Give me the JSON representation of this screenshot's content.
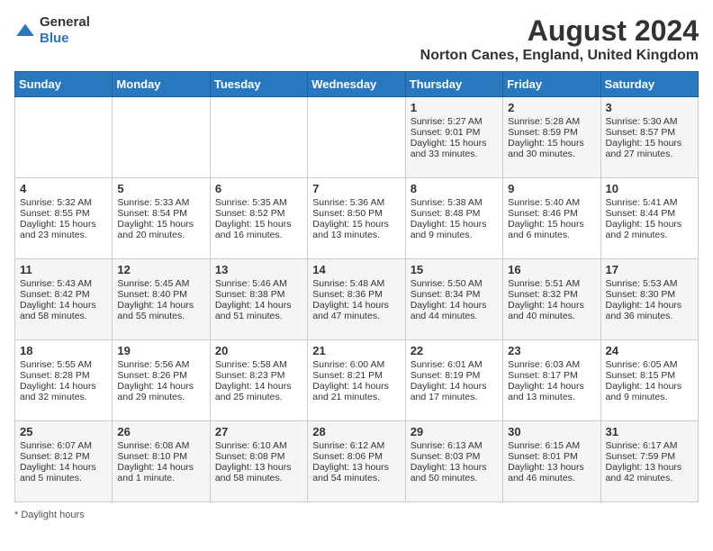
{
  "header": {
    "logo_general": "General",
    "logo_blue": "Blue",
    "main_title": "August 2024",
    "subtitle": "Norton Canes, England, United Kingdom"
  },
  "days_of_week": [
    "Sunday",
    "Monday",
    "Tuesday",
    "Wednesday",
    "Thursday",
    "Friday",
    "Saturday"
  ],
  "weeks": [
    [
      {
        "day": "",
        "sunrise": "",
        "sunset": "",
        "daylight": ""
      },
      {
        "day": "",
        "sunrise": "",
        "sunset": "",
        "daylight": ""
      },
      {
        "day": "",
        "sunrise": "",
        "sunset": "",
        "daylight": ""
      },
      {
        "day": "",
        "sunrise": "",
        "sunset": "",
        "daylight": ""
      },
      {
        "day": "1",
        "sunrise": "Sunrise: 5:27 AM",
        "sunset": "Sunset: 9:01 PM",
        "daylight": "Daylight: 15 hours and 33 minutes."
      },
      {
        "day": "2",
        "sunrise": "Sunrise: 5:28 AM",
        "sunset": "Sunset: 8:59 PM",
        "daylight": "Daylight: 15 hours and 30 minutes."
      },
      {
        "day": "3",
        "sunrise": "Sunrise: 5:30 AM",
        "sunset": "Sunset: 8:57 PM",
        "daylight": "Daylight: 15 hours and 27 minutes."
      }
    ],
    [
      {
        "day": "4",
        "sunrise": "Sunrise: 5:32 AM",
        "sunset": "Sunset: 8:55 PM",
        "daylight": "Daylight: 15 hours and 23 minutes."
      },
      {
        "day": "5",
        "sunrise": "Sunrise: 5:33 AM",
        "sunset": "Sunset: 8:54 PM",
        "daylight": "Daylight: 15 hours and 20 minutes."
      },
      {
        "day": "6",
        "sunrise": "Sunrise: 5:35 AM",
        "sunset": "Sunset: 8:52 PM",
        "daylight": "Daylight: 15 hours and 16 minutes."
      },
      {
        "day": "7",
        "sunrise": "Sunrise: 5:36 AM",
        "sunset": "Sunset: 8:50 PM",
        "daylight": "Daylight: 15 hours and 13 minutes."
      },
      {
        "day": "8",
        "sunrise": "Sunrise: 5:38 AM",
        "sunset": "Sunset: 8:48 PM",
        "daylight": "Daylight: 15 hours and 9 minutes."
      },
      {
        "day": "9",
        "sunrise": "Sunrise: 5:40 AM",
        "sunset": "Sunset: 8:46 PM",
        "daylight": "Daylight: 15 hours and 6 minutes."
      },
      {
        "day": "10",
        "sunrise": "Sunrise: 5:41 AM",
        "sunset": "Sunset: 8:44 PM",
        "daylight": "Daylight: 15 hours and 2 minutes."
      }
    ],
    [
      {
        "day": "11",
        "sunrise": "Sunrise: 5:43 AM",
        "sunset": "Sunset: 8:42 PM",
        "daylight": "Daylight: 14 hours and 58 minutes."
      },
      {
        "day": "12",
        "sunrise": "Sunrise: 5:45 AM",
        "sunset": "Sunset: 8:40 PM",
        "daylight": "Daylight: 14 hours and 55 minutes."
      },
      {
        "day": "13",
        "sunrise": "Sunrise: 5:46 AM",
        "sunset": "Sunset: 8:38 PM",
        "daylight": "Daylight: 14 hours and 51 minutes."
      },
      {
        "day": "14",
        "sunrise": "Sunrise: 5:48 AM",
        "sunset": "Sunset: 8:36 PM",
        "daylight": "Daylight: 14 hours and 47 minutes."
      },
      {
        "day": "15",
        "sunrise": "Sunrise: 5:50 AM",
        "sunset": "Sunset: 8:34 PM",
        "daylight": "Daylight: 14 hours and 44 minutes."
      },
      {
        "day": "16",
        "sunrise": "Sunrise: 5:51 AM",
        "sunset": "Sunset: 8:32 PM",
        "daylight": "Daylight: 14 hours and 40 minutes."
      },
      {
        "day": "17",
        "sunrise": "Sunrise: 5:53 AM",
        "sunset": "Sunset: 8:30 PM",
        "daylight": "Daylight: 14 hours and 36 minutes."
      }
    ],
    [
      {
        "day": "18",
        "sunrise": "Sunrise: 5:55 AM",
        "sunset": "Sunset: 8:28 PM",
        "daylight": "Daylight: 14 hours and 32 minutes."
      },
      {
        "day": "19",
        "sunrise": "Sunrise: 5:56 AM",
        "sunset": "Sunset: 8:26 PM",
        "daylight": "Daylight: 14 hours and 29 minutes."
      },
      {
        "day": "20",
        "sunrise": "Sunrise: 5:58 AM",
        "sunset": "Sunset: 8:23 PM",
        "daylight": "Daylight: 14 hours and 25 minutes."
      },
      {
        "day": "21",
        "sunrise": "Sunrise: 6:00 AM",
        "sunset": "Sunset: 8:21 PM",
        "daylight": "Daylight: 14 hours and 21 minutes."
      },
      {
        "day": "22",
        "sunrise": "Sunrise: 6:01 AM",
        "sunset": "Sunset: 8:19 PM",
        "daylight": "Daylight: 14 hours and 17 minutes."
      },
      {
        "day": "23",
        "sunrise": "Sunrise: 6:03 AM",
        "sunset": "Sunset: 8:17 PM",
        "daylight": "Daylight: 14 hours and 13 minutes."
      },
      {
        "day": "24",
        "sunrise": "Sunrise: 6:05 AM",
        "sunset": "Sunset: 8:15 PM",
        "daylight": "Daylight: 14 hours and 9 minutes."
      }
    ],
    [
      {
        "day": "25",
        "sunrise": "Sunrise: 6:07 AM",
        "sunset": "Sunset: 8:12 PM",
        "daylight": "Daylight: 14 hours and 5 minutes."
      },
      {
        "day": "26",
        "sunrise": "Sunrise: 6:08 AM",
        "sunset": "Sunset: 8:10 PM",
        "daylight": "Daylight: 14 hours and 1 minute."
      },
      {
        "day": "27",
        "sunrise": "Sunrise: 6:10 AM",
        "sunset": "Sunset: 8:08 PM",
        "daylight": "Daylight: 13 hours and 58 minutes."
      },
      {
        "day": "28",
        "sunrise": "Sunrise: 6:12 AM",
        "sunset": "Sunset: 8:06 PM",
        "daylight": "Daylight: 13 hours and 54 minutes."
      },
      {
        "day": "29",
        "sunrise": "Sunrise: 6:13 AM",
        "sunset": "Sunset: 8:03 PM",
        "daylight": "Daylight: 13 hours and 50 minutes."
      },
      {
        "day": "30",
        "sunrise": "Sunrise: 6:15 AM",
        "sunset": "Sunset: 8:01 PM",
        "daylight": "Daylight: 13 hours and 46 minutes."
      },
      {
        "day": "31",
        "sunrise": "Sunrise: 6:17 AM",
        "sunset": "Sunset: 7:59 PM",
        "daylight": "Daylight: 13 hours and 42 minutes."
      }
    ]
  ],
  "footer": "Daylight hours"
}
